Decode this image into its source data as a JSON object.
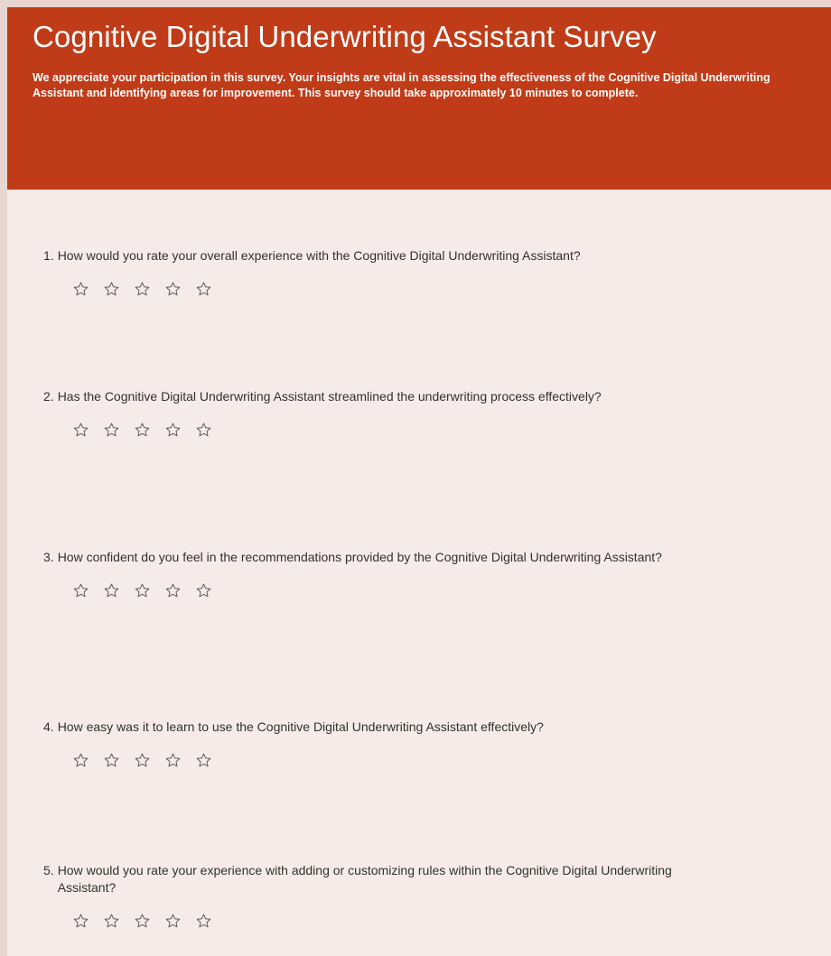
{
  "form": {
    "title": "Cognitive Digital Underwriting Assistant Survey",
    "description": "We appreciate your participation in this survey. Your insights are vital in assessing the effectiveness of the Cognitive Digital Underwriting Assistant and identifying areas for improvement. This survey should take approximately 10 minutes to complete."
  },
  "colors": {
    "header_bg": "#c03c18",
    "page_bg": "#f7ebe7",
    "text": "#323130",
    "star_outline": "#605e5c"
  },
  "questions": [
    {
      "number": "1.",
      "text": "How would you rate your overall experience with the Cognitive Digital Underwriting Assistant?",
      "rating_max": 5,
      "rating_value": 0
    },
    {
      "number": "2.",
      "text": "Has the Cognitive Digital Underwriting Assistant streamlined the underwriting process effectively?",
      "rating_max": 5,
      "rating_value": 0
    },
    {
      "number": "3.",
      "text": "How confident do you feel in the recommendations provided by the Cognitive Digital Underwriting Assistant?",
      "rating_max": 5,
      "rating_value": 0
    },
    {
      "number": "4.",
      "text": "How easy was it to learn to use the Cognitive Digital Underwriting Assistant effectively?",
      "rating_max": 5,
      "rating_value": 0
    },
    {
      "number": "5.",
      "text": "How would you rate your experience with adding or customizing rules within the Cognitive Digital Underwriting Assistant?",
      "rating_max": 5,
      "rating_value": 0
    }
  ],
  "icons": {
    "rating_star": "star-outline-icon"
  }
}
